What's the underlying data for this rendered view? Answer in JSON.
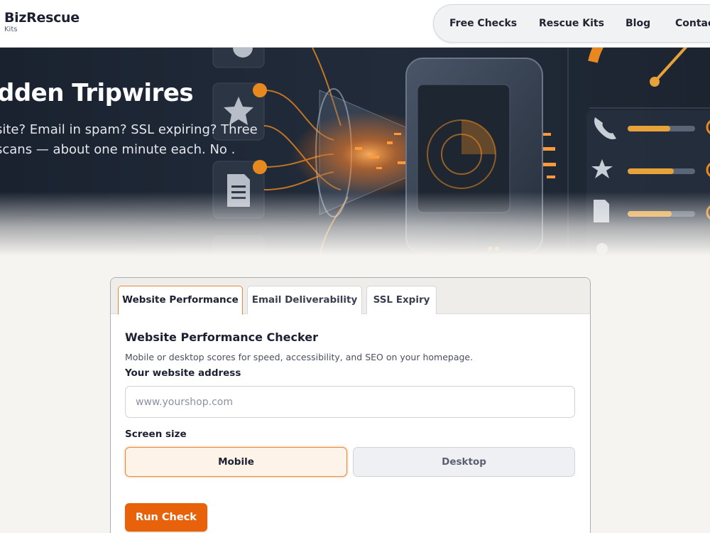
{
  "brand": {
    "name": "BizRescue",
    "sub": "Kits"
  },
  "nav": {
    "items": [
      {
        "label": "Free Checks"
      },
      {
        "label": "Rescue Kits"
      },
      {
        "label": "Blog"
      },
      {
        "label": "Contact"
      }
    ]
  },
  "hero": {
    "title": "dden Tripwires",
    "text": "site? Email in spam? SSL expiring? Three scans — about one minute each. No ."
  },
  "checker": {
    "tabs": [
      {
        "label": "Website Performance",
        "active": true
      },
      {
        "label": "Email Deliverability",
        "active": false
      },
      {
        "label": "SSL Expiry",
        "active": false
      }
    ],
    "title": "Website Performance Checker",
    "description": "Mobile or desktop scores for speed, accessibility, and SEO on your homepage.",
    "url_label": "Your website address",
    "url_placeholder": "www.yourshop.com",
    "url_value": "",
    "screen_label": "Screen size",
    "screen_options": [
      {
        "label": "Mobile",
        "selected": true
      },
      {
        "label": "Desktop",
        "selected": false
      }
    ],
    "run_label": "Run Check"
  },
  "colors": {
    "accent": "#e8620c",
    "accent_border": "#e8893a",
    "hero_bg": "#1f2836",
    "page_bg": "#f6f4f0"
  },
  "icons": {
    "hero": [
      "star-icon",
      "document-icon",
      "phone-icon",
      "gauge-icon",
      "location-pin-icon",
      "speaker-cone-icon"
    ]
  }
}
